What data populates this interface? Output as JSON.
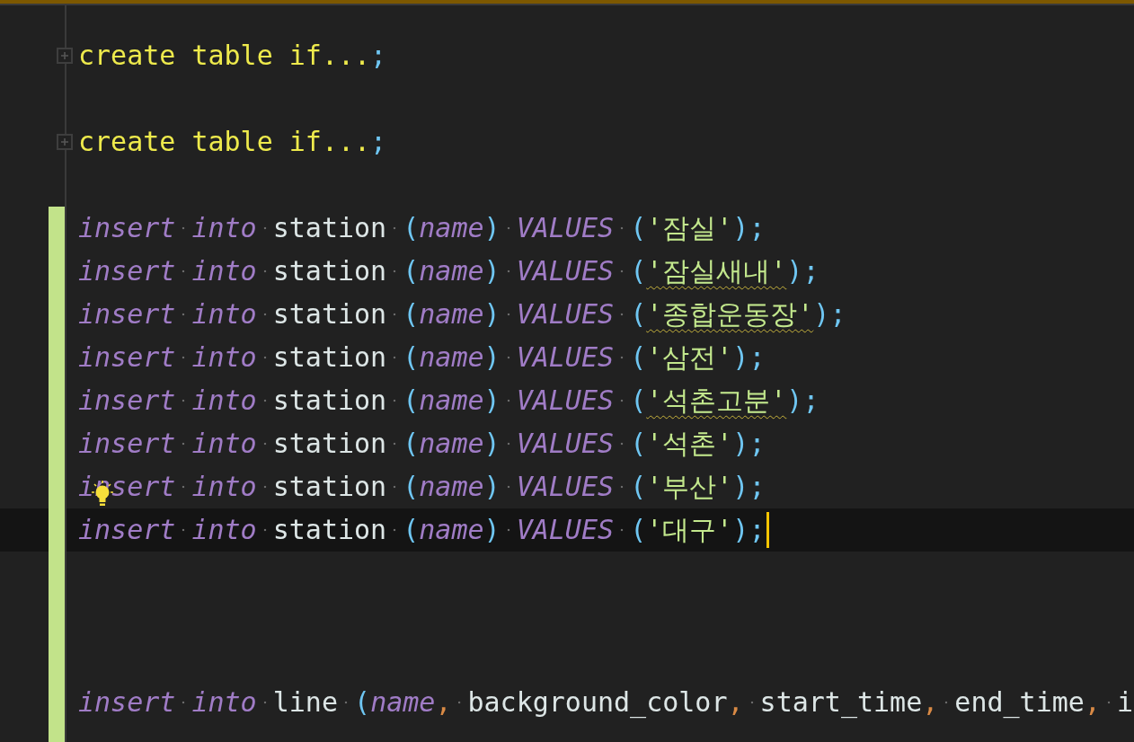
{
  "editor": {
    "lines": [
      {
        "kind": "folded",
        "changed": false,
        "tokens": [
          {
            "kind": "fold_text",
            "text": "create table if..."
          },
          {
            "kind": "semicolon",
            "text": ";"
          }
        ]
      },
      {
        "kind": "blank",
        "changed": false
      },
      {
        "kind": "folded",
        "changed": false,
        "tokens": [
          {
            "kind": "fold_text",
            "text": "create table if..."
          },
          {
            "kind": "semicolon",
            "text": ";"
          }
        ]
      },
      {
        "kind": "blank",
        "changed": false
      },
      {
        "kind": "code",
        "changed": true,
        "tokens": [
          {
            "kind": "keyword",
            "text": "insert",
            "space_after": true
          },
          {
            "kind": "keyword",
            "text": "into",
            "space_after": true
          },
          {
            "kind": "ident",
            "text": "station",
            "space_after": true
          },
          {
            "kind": "paren",
            "text": "("
          },
          {
            "kind": "param",
            "text": "name"
          },
          {
            "kind": "paren",
            "text": ")",
            "space_after": true
          },
          {
            "kind": "keyword",
            "text": "VALUES",
            "space_after": true
          },
          {
            "kind": "paren",
            "text": "("
          },
          {
            "kind": "string",
            "text": "'잠실'",
            "typo": false
          },
          {
            "kind": "paren",
            "text": ")"
          },
          {
            "kind": "semicolon",
            "text": ";"
          }
        ]
      },
      {
        "kind": "code",
        "changed": true,
        "tokens": [
          {
            "kind": "keyword",
            "text": "insert",
            "space_after": true
          },
          {
            "kind": "keyword",
            "text": "into",
            "space_after": true
          },
          {
            "kind": "ident",
            "text": "station",
            "space_after": true
          },
          {
            "kind": "paren",
            "text": "("
          },
          {
            "kind": "param",
            "text": "name"
          },
          {
            "kind": "paren",
            "text": ")",
            "space_after": true
          },
          {
            "kind": "keyword",
            "text": "VALUES",
            "space_after": true
          },
          {
            "kind": "paren",
            "text": "("
          },
          {
            "kind": "string",
            "text": "'잠실새내'",
            "typo": true
          },
          {
            "kind": "paren",
            "text": ")"
          },
          {
            "kind": "semicolon",
            "text": ";"
          }
        ]
      },
      {
        "kind": "code",
        "changed": true,
        "tokens": [
          {
            "kind": "keyword",
            "text": "insert",
            "space_after": true
          },
          {
            "kind": "keyword",
            "text": "into",
            "space_after": true
          },
          {
            "kind": "ident",
            "text": "station",
            "space_after": true
          },
          {
            "kind": "paren",
            "text": "("
          },
          {
            "kind": "param",
            "text": "name"
          },
          {
            "kind": "paren",
            "text": ")",
            "space_after": true
          },
          {
            "kind": "keyword",
            "text": "VALUES",
            "space_after": true
          },
          {
            "kind": "paren",
            "text": "("
          },
          {
            "kind": "string",
            "text": "'종합운동장'",
            "typo": true
          },
          {
            "kind": "paren",
            "text": ")"
          },
          {
            "kind": "semicolon",
            "text": ";"
          }
        ]
      },
      {
        "kind": "code",
        "changed": true,
        "tokens": [
          {
            "kind": "keyword",
            "text": "insert",
            "space_after": true
          },
          {
            "kind": "keyword",
            "text": "into",
            "space_after": true
          },
          {
            "kind": "ident",
            "text": "station",
            "space_after": true
          },
          {
            "kind": "paren",
            "text": "("
          },
          {
            "kind": "param",
            "text": "name"
          },
          {
            "kind": "paren",
            "text": ")",
            "space_after": true
          },
          {
            "kind": "keyword",
            "text": "VALUES",
            "space_after": true
          },
          {
            "kind": "paren",
            "text": "("
          },
          {
            "kind": "string",
            "text": "'삼전'",
            "typo": false
          },
          {
            "kind": "paren",
            "text": ")"
          },
          {
            "kind": "semicolon",
            "text": ";"
          }
        ]
      },
      {
        "kind": "code",
        "changed": true,
        "tokens": [
          {
            "kind": "keyword",
            "text": "insert",
            "space_after": true
          },
          {
            "kind": "keyword",
            "text": "into",
            "space_after": true
          },
          {
            "kind": "ident",
            "text": "station",
            "space_after": true
          },
          {
            "kind": "paren",
            "text": "("
          },
          {
            "kind": "param",
            "text": "name"
          },
          {
            "kind": "paren",
            "text": ")",
            "space_after": true
          },
          {
            "kind": "keyword",
            "text": "VALUES",
            "space_after": true
          },
          {
            "kind": "paren",
            "text": "("
          },
          {
            "kind": "string",
            "text": "'석촌고분'",
            "typo": true
          },
          {
            "kind": "paren",
            "text": ")"
          },
          {
            "kind": "semicolon",
            "text": ";"
          }
        ]
      },
      {
        "kind": "code",
        "changed": true,
        "tokens": [
          {
            "kind": "keyword",
            "text": "insert",
            "space_after": true
          },
          {
            "kind": "keyword",
            "text": "into",
            "space_after": true
          },
          {
            "kind": "ident",
            "text": "station",
            "space_after": true
          },
          {
            "kind": "paren",
            "text": "("
          },
          {
            "kind": "param",
            "text": "name"
          },
          {
            "kind": "paren",
            "text": ")",
            "space_after": true
          },
          {
            "kind": "keyword",
            "text": "VALUES",
            "space_after": true
          },
          {
            "kind": "paren",
            "text": "("
          },
          {
            "kind": "string",
            "text": "'석촌'",
            "typo": false
          },
          {
            "kind": "paren",
            "text": ")"
          },
          {
            "kind": "semicolon",
            "text": ";"
          }
        ]
      },
      {
        "kind": "code",
        "changed": true,
        "bulb": true,
        "tokens": [
          {
            "kind": "keyword",
            "text": "insert",
            "space_after": true
          },
          {
            "kind": "keyword",
            "text": "into",
            "space_after": true
          },
          {
            "kind": "ident",
            "text": "station",
            "space_after": true
          },
          {
            "kind": "paren",
            "text": "("
          },
          {
            "kind": "param",
            "text": "name"
          },
          {
            "kind": "paren",
            "text": ")",
            "space_after": true
          },
          {
            "kind": "keyword",
            "text": "VALUES",
            "space_after": true
          },
          {
            "kind": "paren",
            "text": "("
          },
          {
            "kind": "string",
            "text": "'부산'",
            "typo": false
          },
          {
            "kind": "paren",
            "text": ")"
          },
          {
            "kind": "semicolon",
            "text": ";"
          }
        ]
      },
      {
        "kind": "code",
        "changed": true,
        "current": true,
        "caret": true,
        "tokens": [
          {
            "kind": "keyword",
            "text": "insert",
            "space_after": true
          },
          {
            "kind": "keyword",
            "text": "into",
            "space_after": true
          },
          {
            "kind": "ident",
            "text": "station",
            "space_after": true
          },
          {
            "kind": "paren",
            "text": "("
          },
          {
            "kind": "param",
            "text": "name"
          },
          {
            "kind": "paren",
            "text": ")",
            "space_after": true
          },
          {
            "kind": "keyword",
            "text": "VALUES",
            "space_after": true
          },
          {
            "kind": "paren",
            "text": "("
          },
          {
            "kind": "string",
            "text": "'대구'",
            "typo": false
          },
          {
            "kind": "paren",
            "text": ")"
          },
          {
            "kind": "semicolon",
            "text": ";"
          }
        ]
      },
      {
        "kind": "blank",
        "changed": true
      },
      {
        "kind": "blank",
        "changed": true
      },
      {
        "kind": "blank",
        "changed": true
      },
      {
        "kind": "code",
        "changed": true,
        "tokens": [
          {
            "kind": "keyword",
            "text": "insert",
            "space_after": true
          },
          {
            "kind": "keyword",
            "text": "into",
            "space_after": true
          },
          {
            "kind": "ident",
            "text": "line",
            "space_after": true
          },
          {
            "kind": "paren",
            "text": "("
          },
          {
            "kind": "param",
            "text": "name"
          },
          {
            "kind": "comma",
            "text": ",",
            "space_after": true
          },
          {
            "kind": "ident",
            "text": "background_color"
          },
          {
            "kind": "comma",
            "text": ",",
            "space_after": true
          },
          {
            "kind": "ident",
            "text": "start_time"
          },
          {
            "kind": "comma",
            "text": ",",
            "space_after": true
          },
          {
            "kind": "ident",
            "text": "end_time"
          },
          {
            "kind": "comma",
            "text": ",",
            "space_after": true
          },
          {
            "kind": "ident",
            "text": "i"
          }
        ]
      },
      {
        "kind": "blank",
        "changed": true
      }
    ]
  }
}
